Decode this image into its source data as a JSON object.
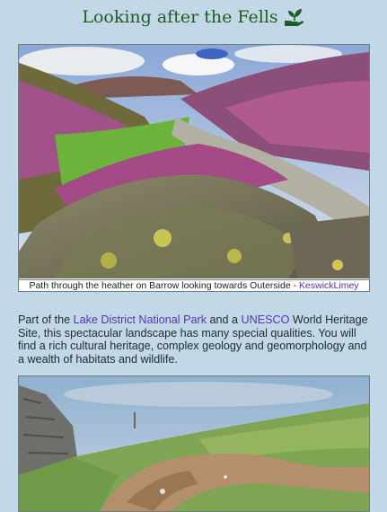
{
  "header": {
    "title": "Looking after the Fells",
    "icon": "hand-seedling-icon",
    "title_color": "#1e5e24"
  },
  "figure1": {
    "caption_text": "Path through the heather on Barrow looking towards Outerside - ",
    "credit_link": "KeswickLimey",
    "link_color": "#5a31b8"
  },
  "intro": {
    "part1": "Part of the ",
    "link1": "Lake District National Park",
    "part2": " and a ",
    "link2": "UNESCO",
    "part3": " World Heritage Site, this spectacular landscape has many special qualities. You will find a rich cultural heritage, complex geology and geomorphology and a wealth of habitats and wildlife."
  },
  "colors": {
    "background": "#c2d8e6",
    "text": "#1f2a2e"
  }
}
